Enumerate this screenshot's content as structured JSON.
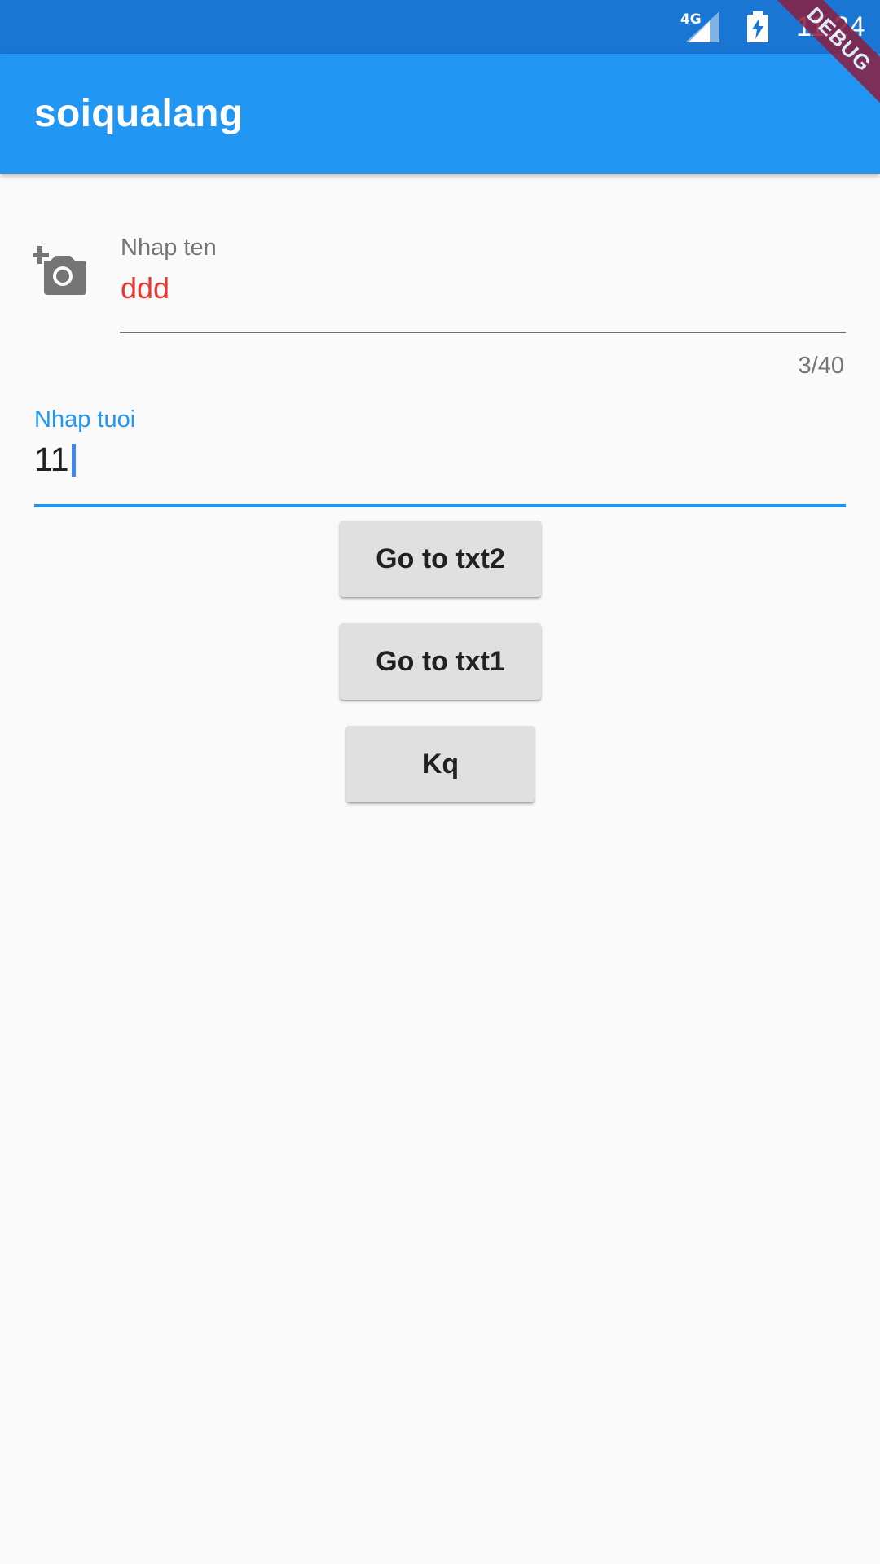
{
  "status_bar": {
    "network": "4G",
    "time": "11:24",
    "icons": [
      "signal-icon",
      "battery-charging-icon"
    ]
  },
  "app_bar": {
    "title": "soiqualang",
    "debug_banner": "DEBUG",
    "color": "#2196f3"
  },
  "form": {
    "name_field": {
      "icon": "add-a-photo-icon",
      "label": "Nhap ten",
      "value": "ddd",
      "counter": "3/40",
      "value_color": "#e53935"
    },
    "age_field": {
      "label": "Nhap tuoi",
      "value": "11",
      "accent": "#2196f3"
    }
  },
  "buttons": {
    "goto_txt2": "Go to txt2",
    "goto_txt1": "Go to txt1",
    "kq": "Kq"
  }
}
